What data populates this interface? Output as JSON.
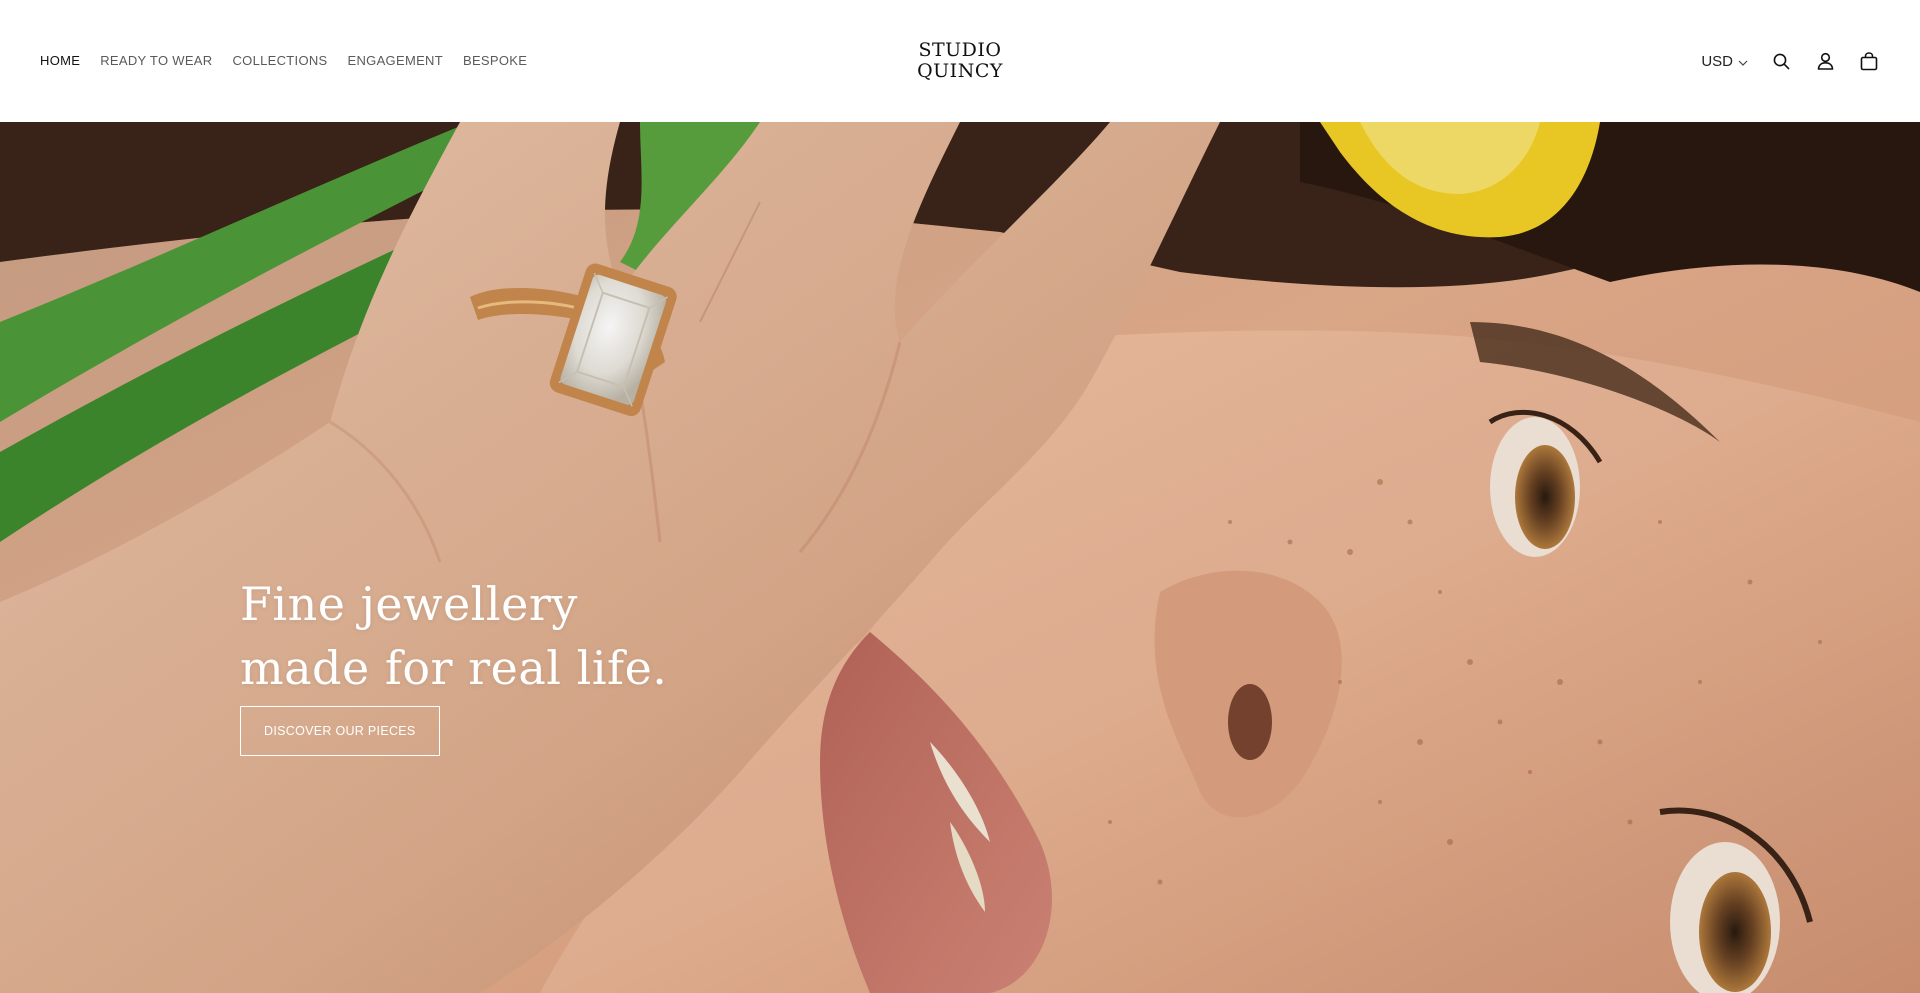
{
  "header": {
    "nav": [
      {
        "label": "HOME",
        "active": true
      },
      {
        "label": "READY TO WEAR",
        "active": false
      },
      {
        "label": "COLLECTIONS",
        "active": false
      },
      {
        "label": "ENGAGEMENT",
        "active": false
      },
      {
        "label": "BESPOKE",
        "active": false
      }
    ],
    "logo": {
      "line1": "STUDIO",
      "line2": "QUINCY"
    },
    "currency": "USD",
    "icons": [
      "chevron-down-icon",
      "search-icon",
      "account-icon",
      "cart-bag-icon"
    ]
  },
  "hero": {
    "title_line1": "Fine jewellery",
    "title_line2": "made for real life.",
    "button_label": "DISCOVER OUR PIECES",
    "image": "close-up of a freckled face with a hand wearing a gold emerald-cut diamond ring, green stems and a yellow flower in the background"
  },
  "colors": {
    "header_bg": "#ffffff",
    "nav_text": "#5a5a5a",
    "nav_active": "#111111",
    "hero_text": "#ffffff",
    "skin": "#d9a889",
    "gold": "#c98a4e",
    "leaf_green": "#4f9a3a",
    "flower_yellow": "#f2d027"
  }
}
